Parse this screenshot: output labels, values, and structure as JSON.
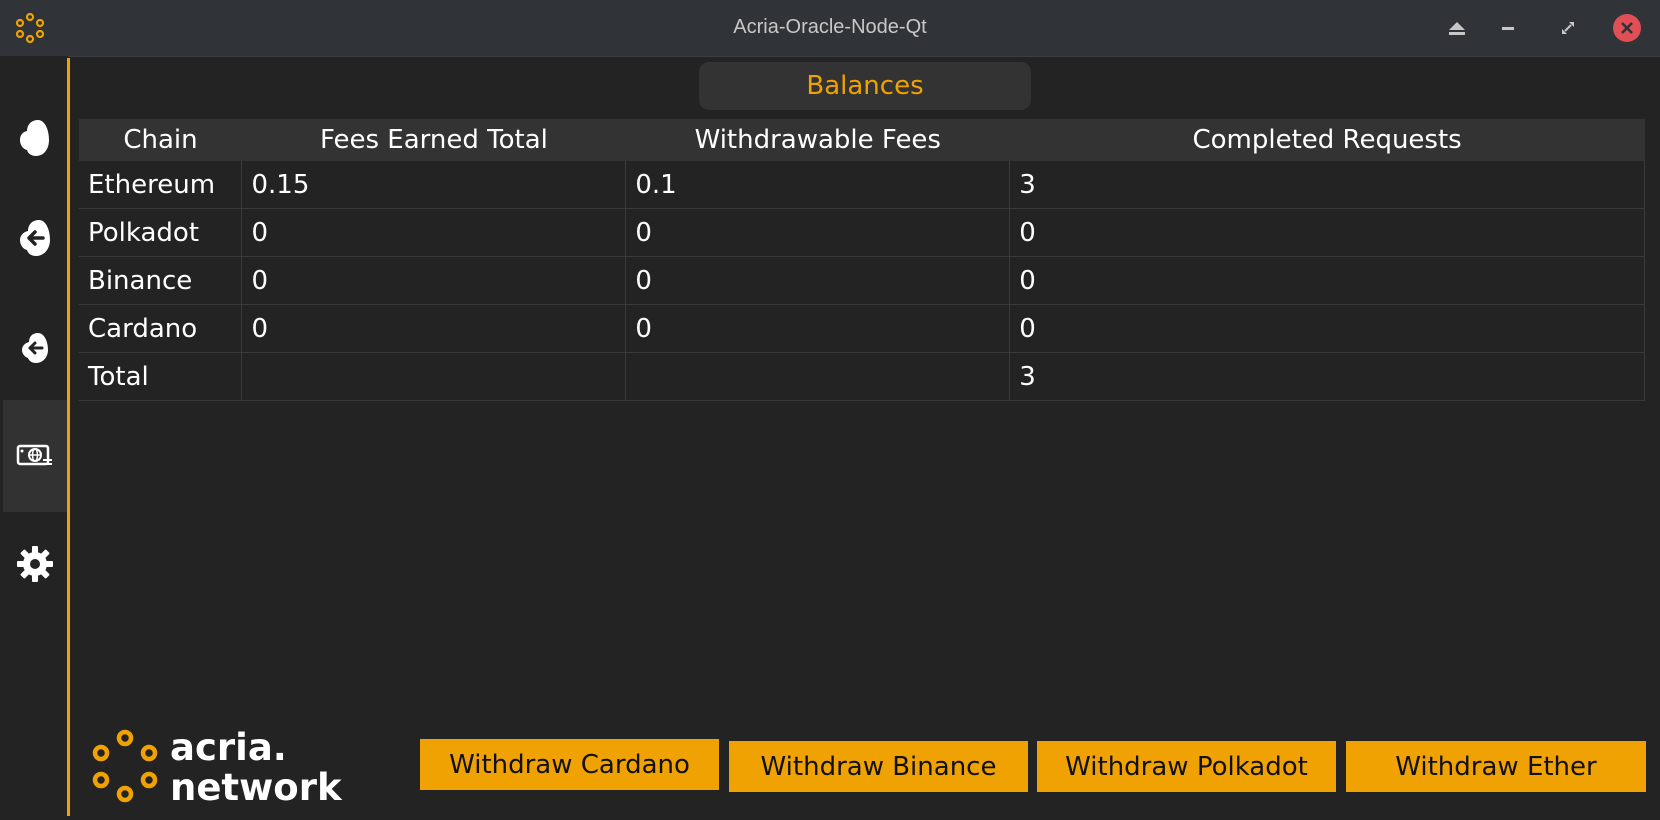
{
  "window": {
    "title": "Acria-Oracle-Node-Qt",
    "accent": "#f0a202",
    "controls": [
      "eject-icon",
      "minimize-icon",
      "maximize-icon",
      "close-icon"
    ]
  },
  "sidebar": {
    "items": [
      {
        "name": "cloud",
        "icon": "cloud-icon",
        "active": false
      },
      {
        "name": "cloud-upload",
        "icon": "cloud-arrow-left-icon",
        "active": false
      },
      {
        "name": "cloud-download",
        "icon": "cloud-arrow-in-icon",
        "active": false
      },
      {
        "name": "balances",
        "icon": "banknote-globe-icon",
        "active": true
      },
      {
        "name": "settings",
        "icon": "gear-icon",
        "active": false
      }
    ]
  },
  "main": {
    "tab_label": "Balances",
    "table": {
      "headers": [
        "Chain",
        "Fees Earned Total",
        "Withdrawable Fees",
        "Completed Requests"
      ],
      "rows": [
        [
          "Ethereum",
          "0.15",
          "0.1",
          "3"
        ],
        [
          "Polkadot",
          "0",
          "0",
          "0"
        ],
        [
          "Binance",
          "0",
          "0",
          "0"
        ],
        [
          "Cardano",
          "0",
          "0",
          "0"
        ],
        [
          "Total",
          "",
          "",
          "3"
        ]
      ]
    }
  },
  "footer": {
    "logo_line1": "acria.",
    "logo_line2": "network",
    "buttons": [
      "Withdraw Cardano",
      "Withdraw Binance",
      "Withdraw Polkadot",
      "Withdraw Ether"
    ]
  }
}
